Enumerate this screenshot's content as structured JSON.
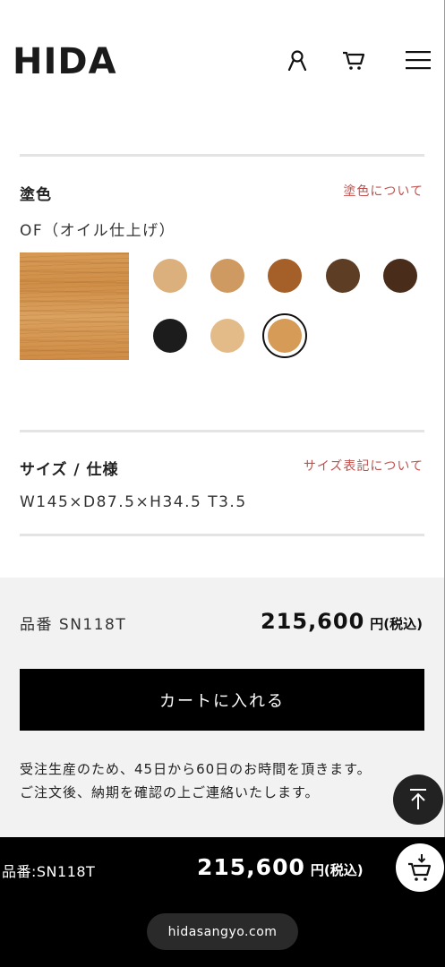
{
  "header": {
    "logo": "HIDA",
    "icons": [
      "user-icon",
      "cart-icon",
      "menu-icon"
    ]
  },
  "finish": {
    "title": "塗色",
    "link": "塗色について",
    "selected": "OF（オイル仕上げ）",
    "swatches": [
      {
        "color": "#dcb07c"
      },
      {
        "color": "#cf9a62"
      },
      {
        "color": "#a55f29"
      },
      {
        "color": "#5d3e25"
      },
      {
        "color": "#4a2c1a"
      },
      {
        "color": "#1c1c1c"
      },
      {
        "color": "#e3bb89"
      },
      {
        "color": "#d59b57",
        "selected": true
      }
    ]
  },
  "size": {
    "title": "サイズ / 仕様",
    "link": "サイズ表記について",
    "value": "W145×D87.5×H34.5 T3.5"
  },
  "purchase": {
    "code": "品番 SN118T",
    "price": "215,600",
    "price_unit": "円(税込)",
    "add_to_cart": "カートに入れる",
    "notice_line1": "受注生産のため、45日から60日のお時間を頂きます。",
    "notice_line2": "ご注文後、納期を確認の上ご連絡いたします。"
  },
  "sticky": {
    "code": "品番:SN118T",
    "price": "215,600",
    "price_unit": "円(税込)"
  },
  "browser": {
    "url": "hidasangyo.com"
  },
  "colors": {
    "accent_link": "#c0504d",
    "button_bg": "#000000",
    "panel_bg": "#f2f2f2"
  }
}
